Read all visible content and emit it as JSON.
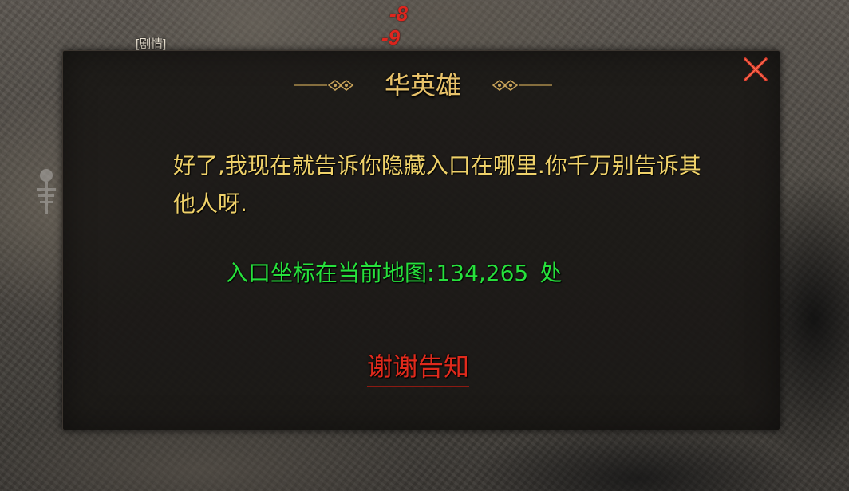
{
  "scene": {
    "damage_numbers": [
      "-8",
      "-9"
    ],
    "plot_tag": "[剧情]"
  },
  "dialog": {
    "title": "华英雄",
    "message": "好了,我现在就告诉你隐藏入口在哪里.你千万别告诉其他人呀.",
    "coord_label": "入口坐标在当前地图:",
    "coord_value": "134,265",
    "coord_suffix": "处",
    "thanks_button": "谢谢告知",
    "close_icon": "close-x-icon"
  },
  "colors": {
    "title": "#e8c26a",
    "message": "#f0d26a",
    "coordinates": "#27e03c",
    "thanks_button": "#e02a1c",
    "close_icon": "#d8382a"
  }
}
